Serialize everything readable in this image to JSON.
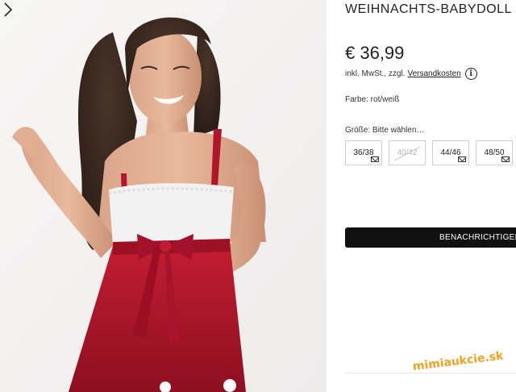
{
  "product": {
    "title": "WEIHNACHTS-BABYDOLL",
    "price": "€ 36,99",
    "tax_prefix": "inkl. MwSt., zzgl.",
    "shipping_link": "Versandkosten",
    "info_icon": "info-circle-icon",
    "color_line": "Farbe: rot/weiß",
    "size_prompt": "Größe: Bitte wählen…",
    "sizes": [
      {
        "label": "36/38",
        "available": false,
        "notify": true
      },
      {
        "label": "40/42",
        "available": false,
        "notify": false
      },
      {
        "label": "44/46",
        "available": false,
        "notify": true
      },
      {
        "label": "48/50",
        "available": false,
        "notify": true
      }
    ],
    "notify_button": "BENACHRICHTIGEN"
  },
  "gallery": {
    "next_icon": "chevron-right-icon"
  },
  "watermark": "mimiaukcie.sk",
  "colors": {
    "text": "#222222",
    "button_bg": "#111111",
    "button_text": "#ffffff",
    "dress_red": "#b0172b",
    "lace_white": "#f2f2f2",
    "watermark": "#f3a21f"
  }
}
